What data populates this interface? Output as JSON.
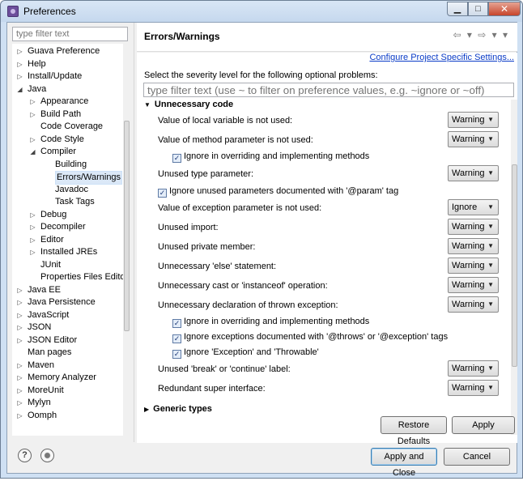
{
  "window": {
    "title": "Preferences",
    "min_label": "▁",
    "max_label": "□",
    "close_label": "✕"
  },
  "left": {
    "filter_placeholder": "type filter text",
    "tree": [
      {
        "label": "Guava Preference",
        "level": 0,
        "twisty": "closed"
      },
      {
        "label": "Help",
        "level": 0,
        "twisty": "closed"
      },
      {
        "label": "Install/Update",
        "level": 0,
        "twisty": "closed"
      },
      {
        "label": "Java",
        "level": 0,
        "twisty": "open"
      },
      {
        "label": "Appearance",
        "level": 1,
        "twisty": "closed"
      },
      {
        "label": "Build Path",
        "level": 1,
        "twisty": "closed"
      },
      {
        "label": "Code Coverage",
        "level": 1,
        "twisty": "none"
      },
      {
        "label": "Code Style",
        "level": 1,
        "twisty": "closed"
      },
      {
        "label": "Compiler",
        "level": 1,
        "twisty": "open"
      },
      {
        "label": "Building",
        "level": 2,
        "twisty": "none"
      },
      {
        "label": "Errors/Warnings",
        "level": 2,
        "twisty": "none",
        "selected": true
      },
      {
        "label": "Javadoc",
        "level": 2,
        "twisty": "none"
      },
      {
        "label": "Task Tags",
        "level": 2,
        "twisty": "none"
      },
      {
        "label": "Debug",
        "level": 1,
        "twisty": "closed"
      },
      {
        "label": "Decompiler",
        "level": 1,
        "twisty": "closed"
      },
      {
        "label": "Editor",
        "level": 1,
        "twisty": "closed"
      },
      {
        "label": "Installed JREs",
        "level": 1,
        "twisty": "closed"
      },
      {
        "label": "JUnit",
        "level": 1,
        "twisty": "none"
      },
      {
        "label": "Properties Files Edito",
        "level": 1,
        "twisty": "none"
      },
      {
        "label": "Java EE",
        "level": 0,
        "twisty": "closed"
      },
      {
        "label": "Java Persistence",
        "level": 0,
        "twisty": "closed"
      },
      {
        "label": "JavaScript",
        "level": 0,
        "twisty": "closed"
      },
      {
        "label": "JSON",
        "level": 0,
        "twisty": "closed"
      },
      {
        "label": "JSON Editor",
        "level": 0,
        "twisty": "closed"
      },
      {
        "label": "Man pages",
        "level": 0,
        "twisty": "none"
      },
      {
        "label": "Maven",
        "level": 0,
        "twisty": "closed"
      },
      {
        "label": "Memory Analyzer",
        "level": 0,
        "twisty": "closed"
      },
      {
        "label": "MoreUnit",
        "level": 0,
        "twisty": "closed"
      },
      {
        "label": "Mylyn",
        "level": 0,
        "twisty": "closed"
      },
      {
        "label": "Oomph",
        "level": 0,
        "twisty": "closed"
      }
    ]
  },
  "page": {
    "title": "Errors/Warnings",
    "nav_icons": "⇦ ▾ ⇨ ▾ ▾",
    "configure_link": "Configure Project Specific Settings...",
    "severity_label": "Select the severity level for the following optional problems:",
    "filter_placeholder": "type filter text (use ~ to filter on preference values, e.g. ~ignore or ~off)",
    "section_title": "Unnecessary code",
    "next_section_title": "Generic types",
    "rows": [
      {
        "label": "Value of local variable is not used:",
        "value": "Warning"
      },
      {
        "label": "Value of method parameter is not used:",
        "value": "Warning"
      },
      {
        "label": "Unused type parameter:",
        "value": "Warning"
      },
      {
        "label": "Value of exception parameter is not used:",
        "value": "Ignore"
      },
      {
        "label": "Unused import:",
        "value": "Warning"
      },
      {
        "label": "Unused private member:",
        "value": "Warning"
      },
      {
        "label": "Unnecessary 'else' statement:",
        "value": "Warning"
      },
      {
        "label": "Unnecessary cast or 'instanceof' operation:",
        "value": "Warning"
      },
      {
        "label": "Unnecessary declaration of thrown exception:",
        "value": "Warning"
      },
      {
        "label": "Unused 'break' or 'continue' label:",
        "value": "Warning"
      },
      {
        "label": "Redundant super interface:",
        "value": "Warning"
      }
    ],
    "checks": {
      "override_param": "Ignore in overriding and implementing methods",
      "param_tag": "Ignore unused parameters documented with '@param' tag",
      "override_throw": "Ignore in overriding and implementing methods",
      "throws_tag": "Ignore exceptions documented with '@throws' or '@exception' tags",
      "exception_throwable": "Ignore 'Exception' and 'Throwable'"
    },
    "restore_defaults": "Restore Defaults",
    "apply": "Apply"
  },
  "footer": {
    "help_icon": "?",
    "apply_and_close": "Apply and Close",
    "cancel": "Cancel"
  }
}
